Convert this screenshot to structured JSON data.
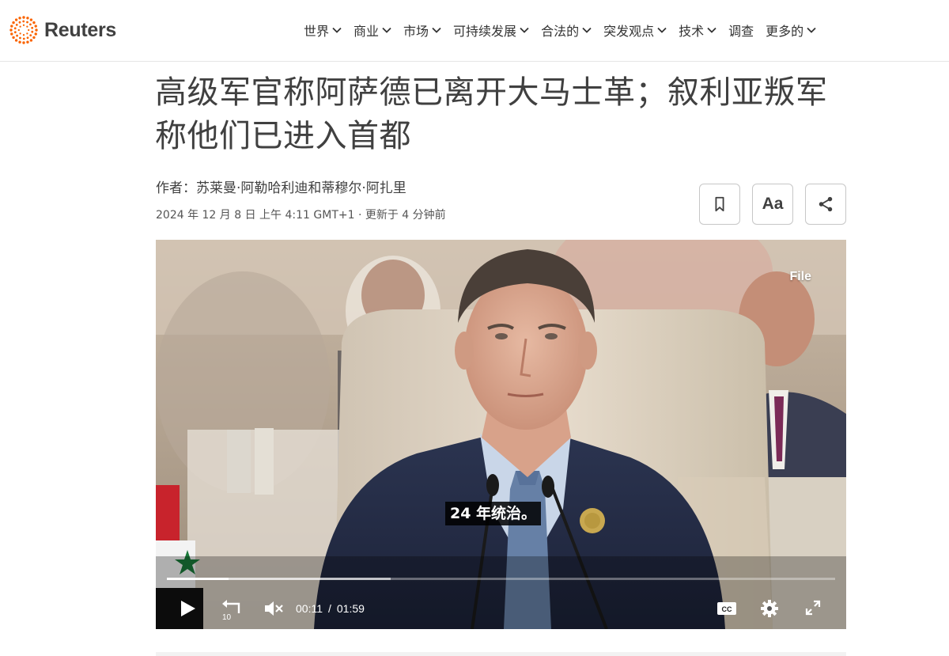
{
  "brand": {
    "name": "Reuters",
    "accent": "#fa6400"
  },
  "nav": [
    {
      "label": "世界",
      "dropdown": true
    },
    {
      "label": "商业",
      "dropdown": true
    },
    {
      "label": "市场",
      "dropdown": true
    },
    {
      "label": "可持续发展",
      "dropdown": true
    },
    {
      "label": "合法的",
      "dropdown": true
    },
    {
      "label": "突发观点",
      "dropdown": true
    },
    {
      "label": "技术",
      "dropdown": true
    },
    {
      "label": "调查",
      "dropdown": false
    },
    {
      "label": "更多的",
      "dropdown": true
    }
  ],
  "article": {
    "headline": "高级军官称阿萨德已离开大马士革；叙利亚叛军称他们已进入首都",
    "byline": "作者：苏莱曼·阿勒哈利迪和蒂穆尔·阿扎里",
    "dateline": "2024 年 12 月 8 日 上午 4:11 GMT+1 · 更新于 4 分钟前"
  },
  "tools": {
    "bookmark_icon": "bookmark-icon",
    "text_size_label": "Aa",
    "share_icon": "share-icon"
  },
  "video": {
    "file_label": "File",
    "caption": "24 年统治。",
    "current_time": "00:11",
    "time_separator": "/",
    "duration": "01:59",
    "played_fraction": 0.092,
    "buffered_fraction": 0.335,
    "skip_back_label": "10",
    "cc_label": "CC"
  }
}
